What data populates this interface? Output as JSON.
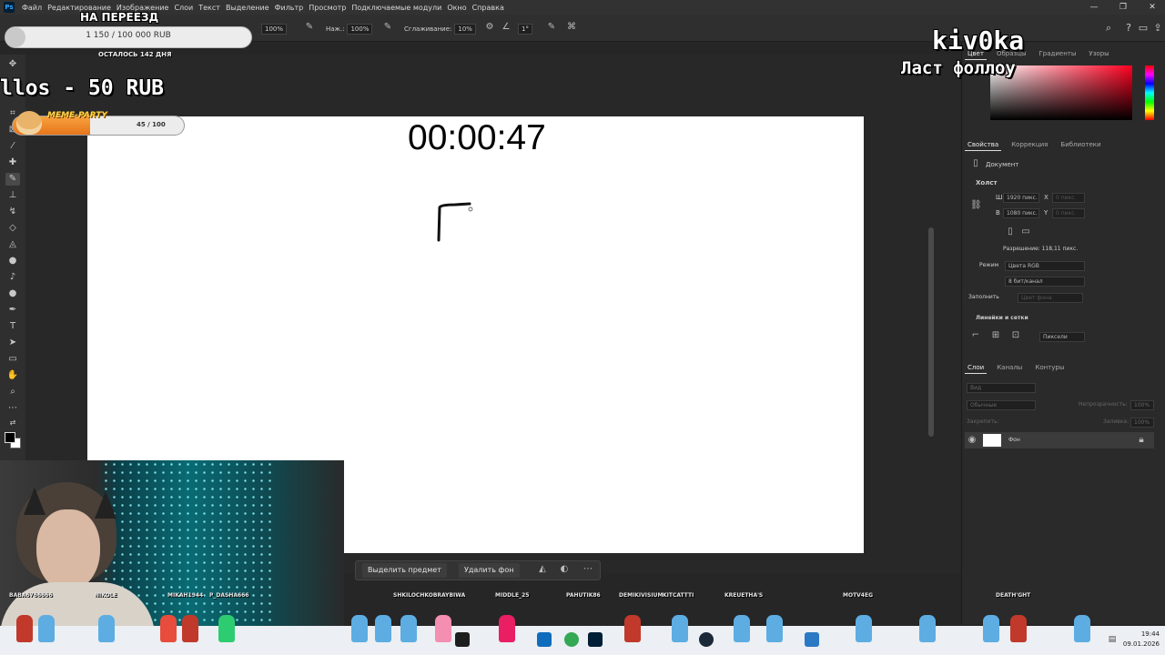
{
  "menu": {
    "items": [
      "Файл",
      "Редактирование",
      "Изображение",
      "Слои",
      "Текст",
      "Выделение",
      "Фильтр",
      "Просмотр",
      "Подключаемые модули",
      "Окно",
      "Справка"
    ]
  },
  "options": {
    "opacity_value": "100%",
    "flow_label": "Наж.:",
    "flow_value": "100%",
    "smoothing_label": "Сглаживание:",
    "smoothing_value": "10%",
    "angle_value": "1°"
  },
  "canvas": {
    "timer": "00:00:47"
  },
  "overlays": {
    "goal_title": "НА ПЕРЕЕЗД",
    "goal_amount": "1 150 / 100 000 RUB",
    "goal_progress_percent": 1.15,
    "goal_days_left": "ОСТАЛОСЬ 142 ДНЯ",
    "marquee": "llos - 50 RUB",
    "meme_title": "MEME-PARTY",
    "meme_count": "45 / 100",
    "meme_progress_percent": 45,
    "nickname": "kiv0ka",
    "last_follow_label": "Ласт фоллоу"
  },
  "right_panel": {
    "color_tabs": [
      "Цвет",
      "Образцы",
      "Градиенты",
      "Узоры"
    ],
    "props_tabs": [
      "Свойства",
      "Коррекция",
      "Библиотеки"
    ],
    "doc_label": "Документ",
    "canvas_section": "Холст",
    "width_label": "Ш",
    "width_value": "1920 пикс.",
    "height_label": "В",
    "height_value": "1080 пикс.",
    "x_label": "X",
    "y_label": "Y",
    "x_placeholder": "0 пикс.",
    "y_placeholder": "0 пикс.",
    "resolution": "Разрешение: 118,11 пикс.",
    "mode_label": "Режим",
    "mode_value": "Цвета RGB",
    "depth_value": "8 бит/канал",
    "fill_label": "Заполнить",
    "fill_value": "Цвет фона",
    "guides_section": "Линейки и сетки",
    "units_value": "Пиксели",
    "layers_tabs": [
      "Слои",
      "Каналы",
      "Контуры"
    ],
    "layer_search": "Вид",
    "blend_mode": "Обычные",
    "opacity_label": "Непрозрачность:",
    "opacity_value": "100%",
    "lock_label": "Закрепить:",
    "fill2_label": "Заливка:",
    "fill2_value": "100%",
    "layer_name": "Фон"
  },
  "context_bar": {
    "select_subject": "Выделить предмет",
    "remove_bg": "Удалить фон"
  },
  "chatters": [
    "BABA6766666",
    "NIKOLE",
    "MIKAH1944",
    "P_DASHA666",
    "SHKILOCHKOBRAYBIWA",
    "MIDDLE_25",
    "PAHUTIK86",
    "DEMIKIVISIUM",
    "KITCATTTI",
    "KREUETHA'S",
    "MOTV4EG",
    "DEATH'GHT"
  ],
  "clock": {
    "time": "19:44",
    "date": "09.01.2026"
  },
  "colors": {
    "menubar": "#323232",
    "panel": "#2a2a2a",
    "workspace": "#282828",
    "meme_fill": "#e7751c",
    "taskbar": "#eceff3"
  }
}
